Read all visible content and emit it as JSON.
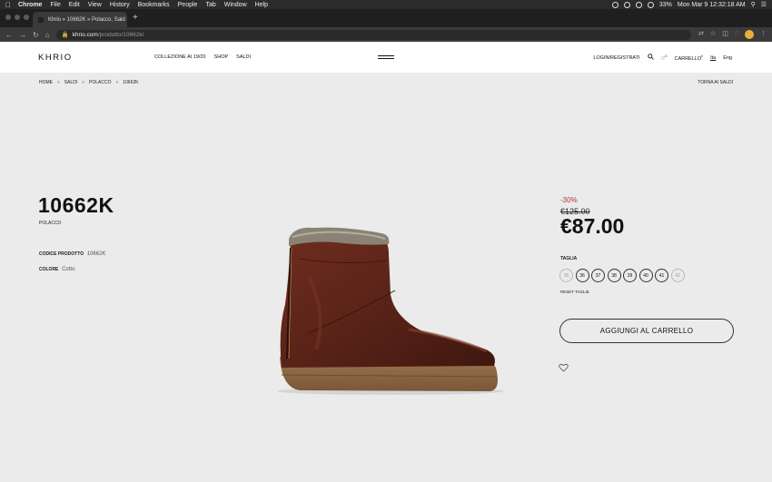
{
  "menubar": {
    "app": "Chrome",
    "items": [
      "File",
      "Edit",
      "View",
      "History",
      "Bookmarks",
      "People",
      "Tab",
      "Window",
      "Help"
    ],
    "battery": "33%",
    "datetime": "Mon Mar 9  12:32:18 AM"
  },
  "browser": {
    "tab_title": "Khrio » 10662K » Polacco, Sald",
    "url_domain": "khrio.com",
    "url_path": "/prodotto/10662k/"
  },
  "site": {
    "logo": "KHRIO",
    "nav": [
      "COLLEZIONE AI 19/20",
      "SHOP",
      "SALDI"
    ],
    "login": "LOGIN/REGISTRATI",
    "wishlist_count": "0",
    "cart_label": "CARRELLO",
    "cart_count": "0",
    "lang_active": "Ita",
    "lang_other": "Eng"
  },
  "breadcrumb": [
    "HOME",
    "SALDI",
    "POLACCO",
    "10662K"
  ],
  "breadcrumb_sep": "»",
  "back_link": "TORNA AI SALDI",
  "product": {
    "name": "10662K",
    "category": "POLACCO",
    "code_label": "CODICE PRODOTTO",
    "code_value": "10662K",
    "color_label": "COLORE",
    "color_value": "Cotto",
    "discount": "-30%",
    "old_price": "€125.00",
    "price": "€87.00",
    "size_label": "TAGLIA",
    "sizes": [
      {
        "label": "35",
        "available": false
      },
      {
        "label": "36",
        "available": true
      },
      {
        "label": "37",
        "available": true
      },
      {
        "label": "38",
        "available": true
      },
      {
        "label": "39",
        "available": true
      },
      {
        "label": "40",
        "available": true
      },
      {
        "label": "41",
        "available": true
      },
      {
        "label": "42",
        "available": false
      }
    ],
    "reset_label": "RESET TAGLIE",
    "add_to_cart": "AGGIUNGI AL CARRELLO"
  },
  "colors": {
    "price_discount": "#b2372b",
    "boot_leather": "#5a2318",
    "boot_sole": "#8f6a45",
    "page_bg": "#ebebeb"
  }
}
